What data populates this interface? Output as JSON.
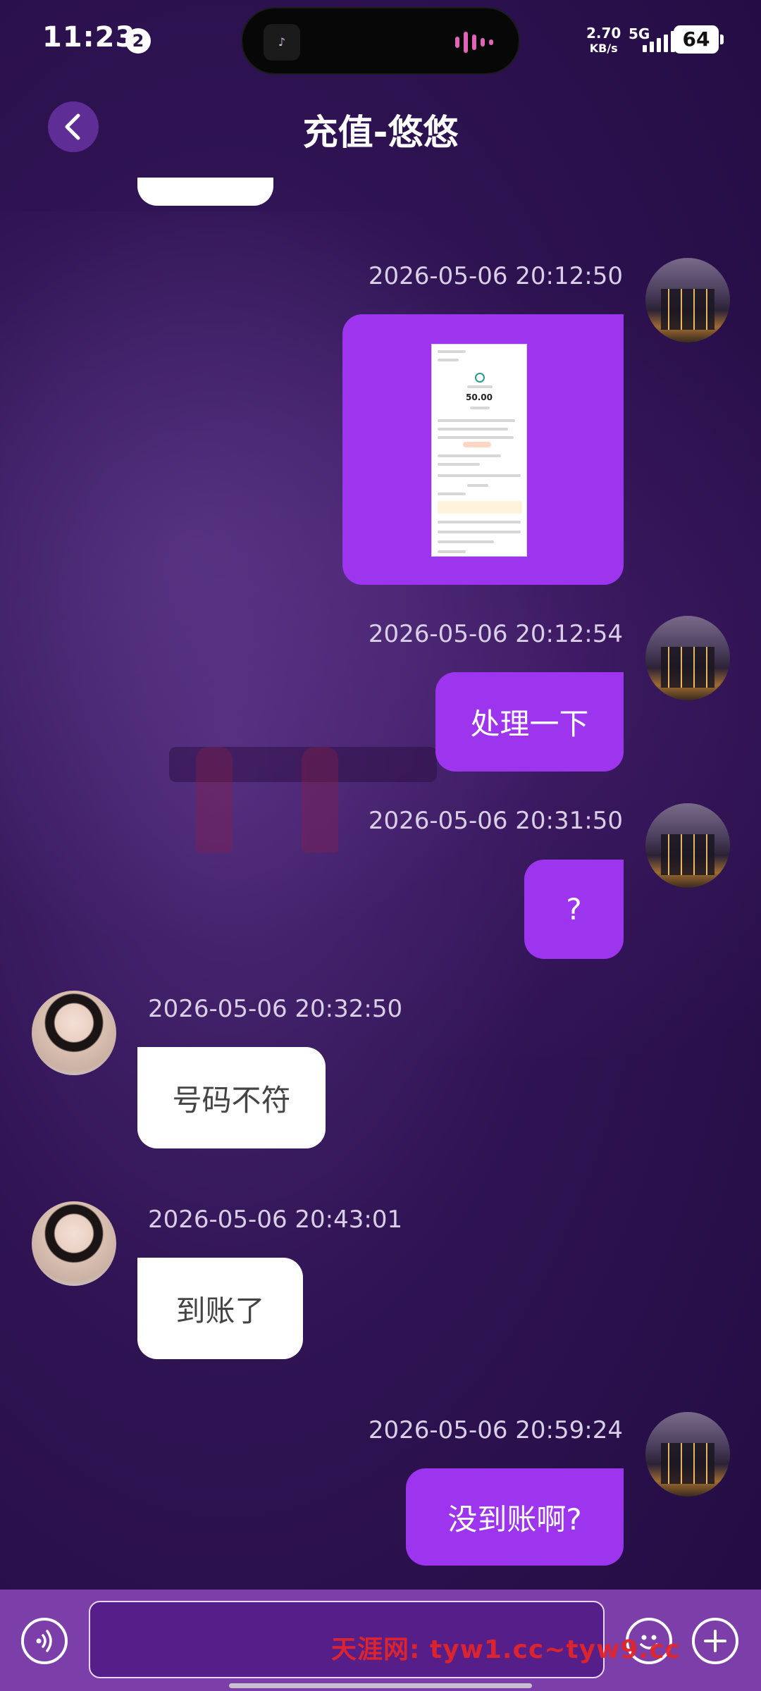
{
  "status_bar": {
    "time": "11:23",
    "notification_count": "2",
    "net_speed_value": "2.70",
    "net_speed_unit": "KB/s",
    "network_type": "5G",
    "battery": "64"
  },
  "header": {
    "title": "充值-悠悠"
  },
  "messages": [
    {
      "sender": "me",
      "timestamp": "2026-05-06 20:12:50",
      "type": "image",
      "image": {
        "amount": "50.00"
      }
    },
    {
      "sender": "me",
      "timestamp": "2026-05-06 20:12:54",
      "type": "text",
      "text": "处理一下"
    },
    {
      "sender": "me",
      "timestamp": "2026-05-06 20:31:50",
      "type": "text",
      "text": "?"
    },
    {
      "sender": "them",
      "timestamp": "2026-05-06 20:32:50",
      "type": "text",
      "text": "号码不符"
    },
    {
      "sender": "them",
      "timestamp": "2026-05-06 20:43:01",
      "type": "text",
      "text": "到账了"
    },
    {
      "sender": "me",
      "timestamp": "2026-05-06 20:59:24",
      "type": "text",
      "text": "没到账啊?"
    }
  ],
  "input_bar": {
    "placeholder": "",
    "watermark": "天涯网: tyw1.cc~tyw9.cc"
  },
  "colors": {
    "accent": "#9d34ee",
    "background": "#2f1353",
    "input_bar": "#7c3ea9"
  }
}
